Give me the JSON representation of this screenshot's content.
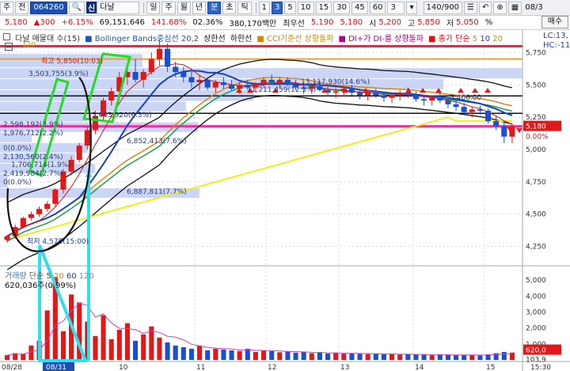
{
  "toolbar": {
    "market": "주",
    "nav": "전",
    "code": "064260",
    "badge": "신",
    "name": "다날",
    "periods": [
      "일",
      "주",
      "월",
      "년",
      "분",
      "초",
      "틱"
    ],
    "active_period": "분",
    "intervals": [
      "1",
      "3",
      "5",
      "10",
      "15",
      "30",
      "45",
      "60"
    ],
    "active_interval": "3",
    "interval_input": "3",
    "count": "140/900",
    "date_right": "08/3"
  },
  "info": {
    "price": "5,180",
    "change_sign": "▲",
    "change": "300",
    "change_pct": "+6.15%",
    "volume": "69,151,646",
    "vol_ratio": "141.68%",
    "turnover_rate": "02.36%",
    "amount": "380,170백만",
    "best_bid_label": "최우선",
    "best_ask": "5,190",
    "best_bid": "5,180",
    "open_label": "시",
    "open": "5,200",
    "high_label": "고",
    "high": "5,850",
    "low_label": "저",
    "low": "5,050"
  },
  "price_panel": {
    "legend": {
      "title": "다날 매물대 수(15)",
      "bb": "Bollinger Bands중심선 20,2",
      "bb_upper": "상한선",
      "bb_lower": "하한선",
      "cci": "CCI기준선 상향돌파",
      "dmi": "DI+가 DI-를 상향돌파",
      "ma_label": "종가 단순",
      "ma_periods": [
        "5",
        "10",
        "20"
      ],
      "ma_sub": "120"
    },
    "right_labels": [
      "LC:13,",
      "HC:-11"
    ],
    "annotations": {
      "high": "최고 5,850(10:03)",
      "low": "최저 4,575(15:00)",
      "vp": [
        "3,503,755(3.9%)",
        "13,117,930(14.6%)",
        "11,211,459(12.5%)",
        "3,603,920(6.3%)",
        "2,598,192(3.9%)",
        "1,976,712(2.2%)",
        "6,852,413(7.6%)",
        "0(0.0%)",
        "2,130,560(2.4%)",
        "1,706,714(1.9%)",
        "2,419,984(2.7%)",
        "0(0.0%)",
        "6,887,811(7.7%)",
        "5,466.00"
      ]
    },
    "y_ticks": [
      "5,750",
      "5,500",
      "5,250",
      "5,000",
      "4,750",
      "4,500",
      "4,250"
    ],
    "price_tag": "5,180",
    "pct_tag": "0.00%"
  },
  "volume_panel": {
    "label": "거래량",
    "ma_label": "단순",
    "ma_periods": [
      "5",
      "20",
      "60",
      "120"
    ],
    "value": "620,036주",
    "pct": "(0.99%)",
    "y_ticks": [
      "5,000",
      "4,000",
      "3,000",
      "2,000",
      "1,000"
    ],
    "tag": "620,0",
    "tag2": "103,9"
  },
  "x_axis": {
    "labels": [
      "08/28",
      "08/31",
      "10",
      "11",
      "12",
      "13",
      "14",
      "15",
      "15:30"
    ]
  },
  "right_panel": {
    "buy": "매수",
    "flag": "기"
  },
  "chart_data": {
    "type": "candlestick",
    "title": "",
    "ylim": [
      4125,
      5900
    ],
    "candles": [
      [
        4300,
        4340,
        4280,
        4330
      ],
      [
        4330,
        4420,
        4310,
        4400
      ],
      [
        4400,
        4480,
        4390,
        4470
      ],
      [
        4470,
        4520,
        4450,
        4500
      ],
      [
        4500,
        4560,
        4480,
        4540
      ],
      [
        4540,
        4600,
        4520,
        4580
      ],
      [
        4580,
        4700,
        4560,
        4690
      ],
      [
        4690,
        4850,
        4660,
        4830
      ],
      [
        4830,
        4950,
        4800,
        4920
      ],
      [
        4920,
        5050,
        4900,
        5030
      ],
      [
        5030,
        5180,
        5000,
        5150
      ],
      [
        5150,
        5300,
        5120,
        5260
      ],
      [
        5260,
        5400,
        5230,
        5380
      ],
      [
        5380,
        5480,
        5340,
        5450
      ],
      [
        5450,
        5600,
        5400,
        5560
      ],
      [
        5560,
        5650,
        5500,
        5600
      ],
      [
        5600,
        5700,
        5520,
        5540
      ],
      [
        5540,
        5620,
        5480,
        5600
      ],
      [
        5600,
        5750,
        5580,
        5700
      ],
      [
        5700,
        5850,
        5650,
        5780
      ],
      [
        5780,
        5820,
        5600,
        5640
      ],
      [
        5640,
        5680,
        5560,
        5600
      ],
      [
        5600,
        5640,
        5520,
        5560
      ],
      [
        5560,
        5600,
        5480,
        5520
      ],
      [
        5520,
        5580,
        5460,
        5540
      ],
      [
        5540,
        5560,
        5460,
        5480
      ],
      [
        5480,
        5540,
        5440,
        5520
      ],
      [
        5520,
        5560,
        5470,
        5500
      ],
      [
        5500,
        5540,
        5450,
        5470
      ],
      [
        5470,
        5520,
        5430,
        5500
      ],
      [
        5500,
        5540,
        5460,
        5480
      ],
      [
        5480,
        5520,
        5440,
        5510
      ],
      [
        5510,
        5560,
        5480,
        5540
      ],
      [
        5540,
        5580,
        5500,
        5520
      ],
      [
        5520,
        5560,
        5480,
        5540
      ],
      [
        5540,
        5560,
        5490,
        5500
      ],
      [
        5500,
        5540,
        5460,
        5480
      ],
      [
        5480,
        5520,
        5430,
        5470
      ],
      [
        5470,
        5510,
        5430,
        5490
      ],
      [
        5490,
        5530,
        5450,
        5460
      ],
      [
        5460,
        5500,
        5410,
        5440
      ],
      [
        5440,
        5480,
        5400,
        5450
      ],
      [
        5450,
        5490,
        5410,
        5470
      ],
      [
        5470,
        5500,
        5420,
        5440
      ],
      [
        5440,
        5470,
        5390,
        5420
      ],
      [
        5420,
        5460,
        5380,
        5440
      ],
      [
        5440,
        5470,
        5400,
        5420
      ],
      [
        5420,
        5450,
        5370,
        5400
      ],
      [
        5400,
        5440,
        5360,
        5420
      ],
      [
        5420,
        5460,
        5380,
        5440
      ],
      [
        5440,
        5480,
        5400,
        5420
      ],
      [
        5420,
        5450,
        5370,
        5390
      ],
      [
        5390,
        5420,
        5340,
        5380
      ],
      [
        5380,
        5420,
        5340,
        5400
      ],
      [
        5400,
        5440,
        5360,
        5380
      ],
      [
        5380,
        5400,
        5320,
        5350
      ],
      [
        5350,
        5380,
        5300,
        5330
      ],
      [
        5330,
        5360,
        5270,
        5290
      ],
      [
        5290,
        5330,
        5250,
        5310
      ],
      [
        5310,
        5340,
        5270,
        5300
      ],
      [
        5300,
        5320,
        5200,
        5220
      ],
      [
        5220,
        5260,
        5150,
        5180
      ],
      [
        5180,
        5220,
        5050,
        5100
      ],
      [
        5100,
        5200,
        5050,
        5180
      ]
    ],
    "volume": [
      300,
      420,
      380,
      900,
      1200,
      3100,
      5200,
      1800,
      4100,
      3600,
      2400,
      1500,
      2800,
      1300,
      1900,
      2300,
      1200,
      1600,
      2100,
      1400,
      1100,
      900,
      800,
      700,
      900,
      600,
      700,
      650,
      600,
      550,
      700,
      500,
      600,
      550,
      480,
      520,
      450,
      500,
      420,
      460,
      400,
      430,
      390,
      410,
      380,
      360,
      400,
      350,
      370,
      330,
      360,
      320,
      340,
      300,
      330,
      310,
      290,
      320,
      300,
      280,
      350,
      420,
      500,
      460
    ]
  }
}
